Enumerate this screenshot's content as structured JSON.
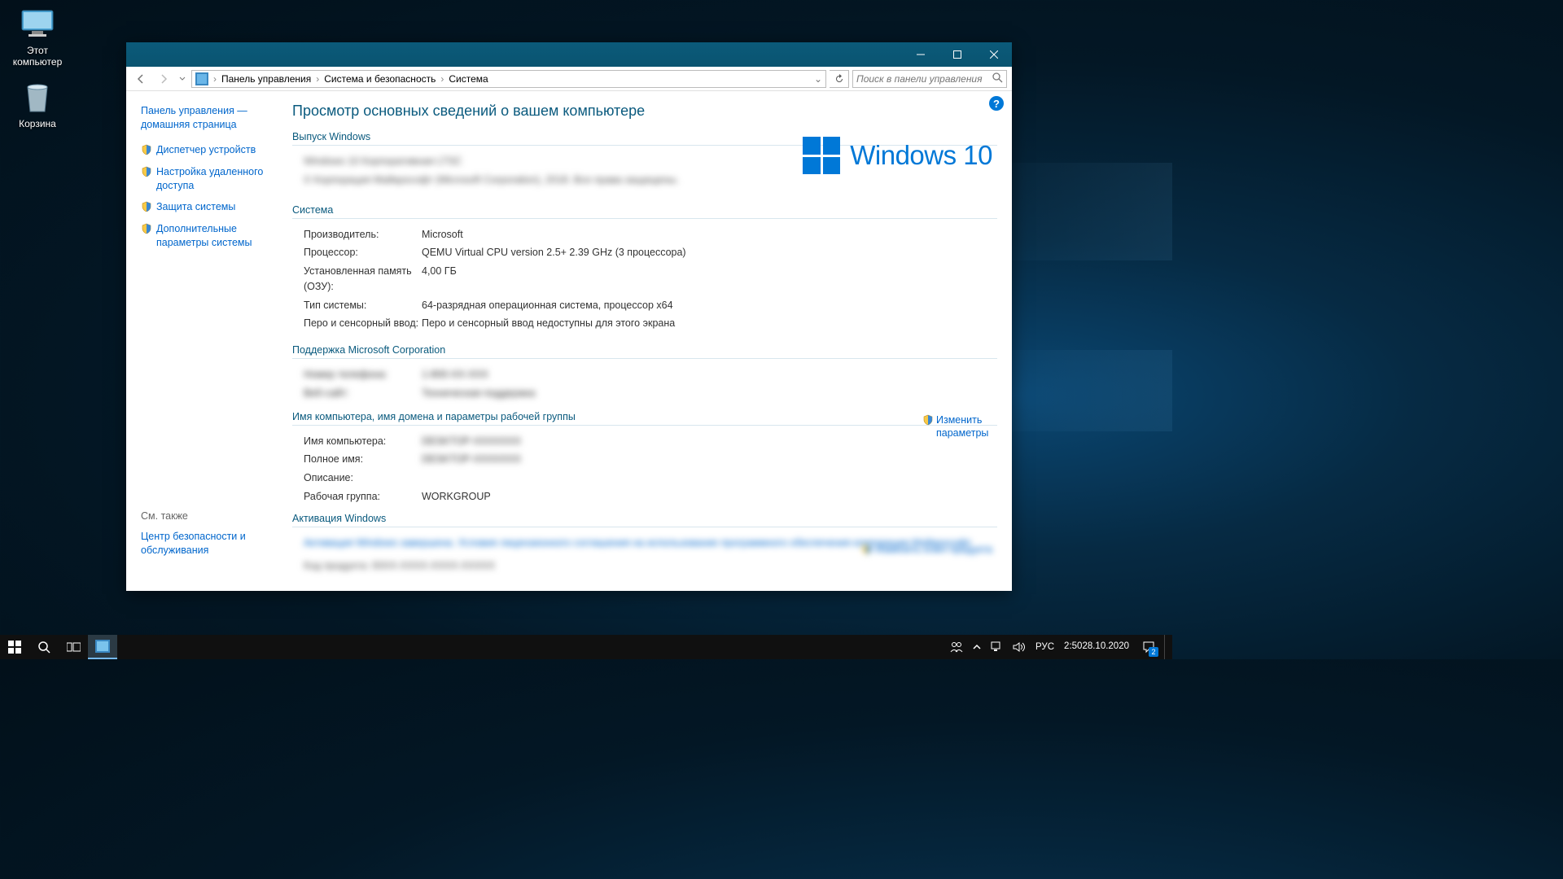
{
  "desktop": {
    "this_pc": "Этот компьютер",
    "recycle": "Корзина"
  },
  "window": {
    "breadcrumb": {
      "root_icon": "control-panel",
      "c1": "Панель управления",
      "c2": "Система и безопасность",
      "c3": "Система"
    },
    "search_placeholder": "Поиск в панели управления"
  },
  "side": {
    "home": "Панель управления — домашняя страница",
    "links": [
      "Диспетчер устройств",
      "Настройка удаленного доступа",
      "Защита системы",
      "Дополнительные параметры системы"
    ],
    "also_h": "См. также",
    "also": "Центр безопасности и обслуживания"
  },
  "main": {
    "title": "Просмотр основных сведений о вашем компьютере",
    "s_edition": "Выпуск Windows",
    "edition_line1": "Windows 10 Корпоративная LTSC",
    "edition_line2": "© Корпорация Майкрософт (Microsoft Corporation), 2018. Все права защищены.",
    "logo_text": "Windows 10",
    "s_system": "Система",
    "sys": {
      "k_manuf": "Производитель:",
      "v_manuf": "Microsoft",
      "k_proc": "Процессор:",
      "v_proc": "QEMU Virtual CPU version 2.5+   2.39 GHz  (3 процессора)",
      "k_ram": "Установленная память (ОЗУ):",
      "v_ram": "4,00 ГБ",
      "k_type": "Тип системы:",
      "v_type": "64-разрядная операционная система, процессор x64",
      "k_pen": "Перо и сенсорный ввод:",
      "v_pen": "Перо и сенсорный ввод недоступны для этого экрана"
    },
    "s_support": "Поддержка Microsoft Corporation",
    "sup": {
      "k_phone": "Номер телефона:",
      "v_phone": "1-800-XX-XXX",
      "k_site": "Веб-сайт:",
      "v_site": "Техническая поддержка"
    },
    "s_name": "Имя компьютера, имя домена и параметры рабочей группы",
    "nm": {
      "k_comp": "Имя компьютера:",
      "v_comp": "DESKTOP-XXXXXXX",
      "k_full": "Полное имя:",
      "v_full": "DESKTOP-XXXXXXX",
      "k_desc": "Описание:",
      "v_desc": "",
      "k_wg": "Рабочая группа:",
      "v_wg": "WORKGROUP"
    },
    "change_link": "Изменить параметры",
    "s_act": "Активация Windows",
    "act_line": "Активация Windows завершена.   Условия лицензионного соглашения на использование программного обеспечения корпорации Майкрософт",
    "act_key": "Код продукта: 00XX-XXXX-XXXX-XXXXX",
    "act_change": "Изменить ключ продукта"
  },
  "taskbar": {
    "lang": "РУС",
    "time": "2:50",
    "date": "28.10.2020",
    "notif_count": "2"
  }
}
